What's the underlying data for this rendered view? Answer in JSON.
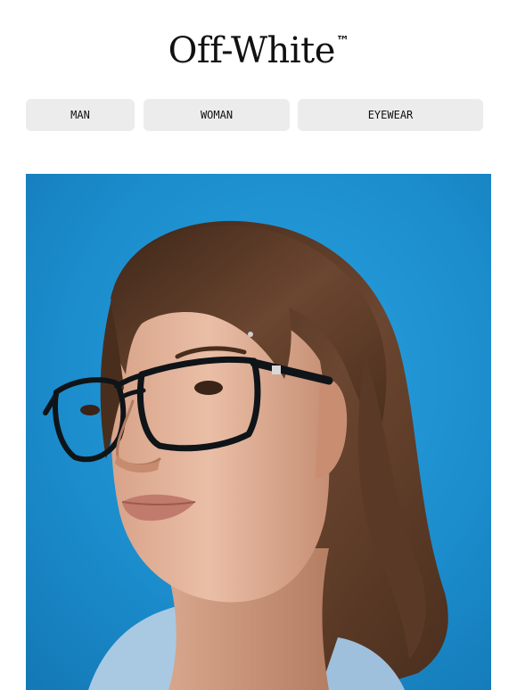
{
  "brand": {
    "name": "Off-White",
    "trademark": "™"
  },
  "nav": {
    "items": [
      {
        "label": "MAN"
      },
      {
        "label": "WOMAN"
      },
      {
        "label": "EYEWEAR"
      }
    ]
  },
  "hero": {
    "icon": "portrait-photo",
    "colors": {
      "background": "#1f8fd0",
      "hair": "#5a3a26",
      "skin": "#e6b79d",
      "frames": "#0f1418",
      "shirt": "#a9c9e3"
    }
  }
}
